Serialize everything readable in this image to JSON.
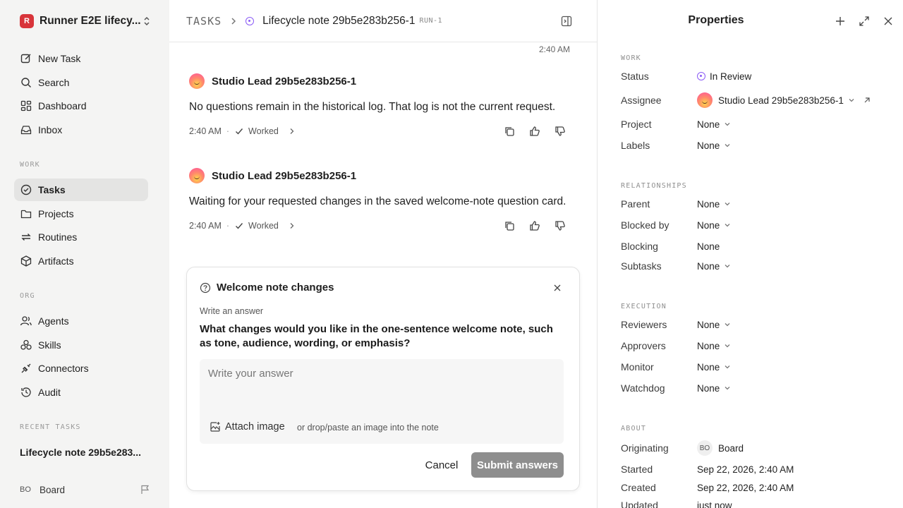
{
  "sidebar": {
    "workspace": {
      "logo": "R",
      "name": "Runner E2E lifecy..."
    },
    "nav_top": [
      {
        "label": "New Task",
        "icon": "new-task-icon"
      },
      {
        "label": "Search",
        "icon": "search-icon"
      },
      {
        "label": "Dashboard",
        "icon": "dashboard-icon"
      },
      {
        "label": "Inbox",
        "icon": "inbox-icon"
      }
    ],
    "work_label": "WORK",
    "nav_work": [
      {
        "label": "Tasks",
        "icon": "tasks-icon",
        "active": true
      },
      {
        "label": "Projects",
        "icon": "folder-icon"
      },
      {
        "label": "Routines",
        "icon": "routines-icon"
      },
      {
        "label": "Artifacts",
        "icon": "box-icon"
      }
    ],
    "org_label": "ORG",
    "nav_org": [
      {
        "label": "Agents",
        "icon": "agents-icon"
      },
      {
        "label": "Skills",
        "icon": "skills-icon"
      },
      {
        "label": "Connectors",
        "icon": "plug-icon"
      },
      {
        "label": "Audit",
        "icon": "history-icon"
      }
    ],
    "recent_label": "RECENT TASKS",
    "recent_tasks": [
      "Lifecycle note 29b5e283..."
    ],
    "user": {
      "initials": "BO",
      "name": "Board"
    }
  },
  "header": {
    "root": "TASKS",
    "title": "Lifecycle note 29b5e283b256-1",
    "badge": "RUN-1"
  },
  "main": {
    "top_time": "2:40 AM",
    "messages": [
      {
        "author": "Studio Lead 29b5e283b256-1",
        "text": "No questions remain in the historical log. That log is not the current request.",
        "time": "2:40 AM",
        "status": "Worked"
      },
      {
        "author": "Studio Lead 29b5e283b256-1",
        "text": "Waiting for your requested changes in the saved welcome-note question card.",
        "time": "2:40 AM",
        "status": "Worked"
      }
    ],
    "question_card": {
      "title": "Welcome note changes",
      "label": "Write an answer",
      "question": "What changes would you like in the one-sentence welcome note, such as tone, audience, wording, or emphasis?",
      "placeholder": "Write your answer",
      "attach_label": "Attach image",
      "attach_hint": "or drop/paste an image into the note",
      "cancel_label": "Cancel",
      "submit_label": "Submit answers"
    }
  },
  "properties": {
    "title": "Properties",
    "work_group": "WORK",
    "status_label": "Status",
    "status_value": "In Review",
    "assignee_label": "Assignee",
    "assignee_value": "Studio Lead 29b5e283b256-1",
    "project_label": "Project",
    "project_value": "None",
    "labels_label": "Labels",
    "labels_value": "None",
    "rel_group": "RELATIONSHIPS",
    "parent_label": "Parent",
    "parent_value": "None",
    "blocked_label": "Blocked by",
    "blocked_value": "None",
    "blocking_label": "Blocking",
    "blocking_value": "None",
    "subtasks_label": "Subtasks",
    "subtasks_value": "None",
    "exec_group": "EXECUTION",
    "reviewers_label": "Reviewers",
    "reviewers_value": "None",
    "approvers_label": "Approvers",
    "approvers_value": "None",
    "monitor_label": "Monitor",
    "monitor_value": "None",
    "watchdog_label": "Watchdog",
    "watchdog_value": "None",
    "about_group": "ABOUT",
    "originating_label": "Originating",
    "originating_initials": "BO",
    "originating_value": "Board",
    "started_label": "Started",
    "started_value": "Sep 22, 2026, 2:40 AM",
    "created_label": "Created",
    "created_value": "Sep 22, 2026, 2:40 AM",
    "updated_label": "Updated",
    "updated_value": "just now"
  },
  "colors": {
    "accent_status": "#8b5cf6",
    "brand": "#d8343a",
    "submit_bg": "#8e8e8e"
  }
}
